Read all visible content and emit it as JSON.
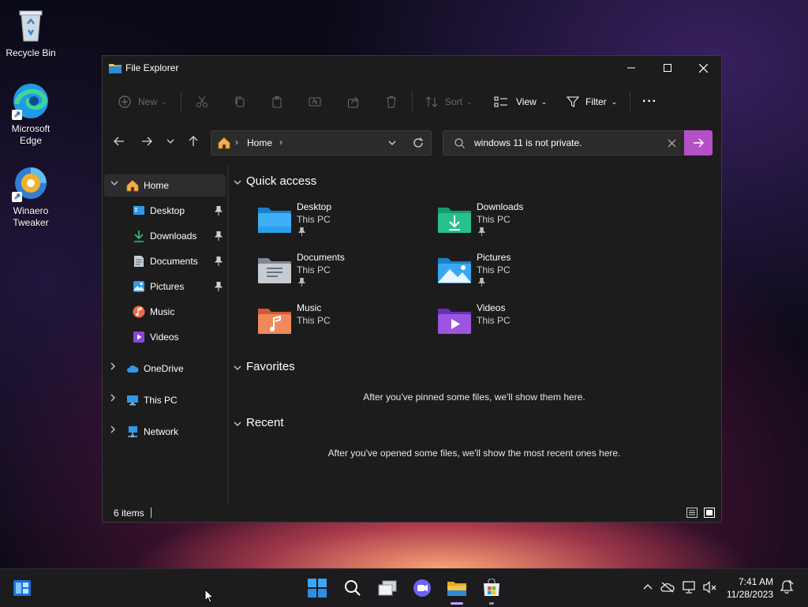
{
  "desktop": {
    "icons": [
      {
        "label": "Recycle Bin"
      },
      {
        "label": "Microsoft Edge"
      },
      {
        "label": "Winaero Tweaker"
      }
    ]
  },
  "window": {
    "title": "File Explorer",
    "controls": {
      "minimize": "—",
      "maximize": "☐",
      "close": "✕"
    }
  },
  "commandbar": {
    "new_label": "New",
    "sort_label": "Sort",
    "view_label": "View",
    "filter_label": "Filter",
    "more_label": "···"
  },
  "address": {
    "crumb": "Home",
    "separator": "›"
  },
  "search": {
    "value": "windows 11 is not private."
  },
  "nav": {
    "home": "Home",
    "quick": [
      {
        "label": "Desktop",
        "pinned": true
      },
      {
        "label": "Downloads",
        "pinned": true
      },
      {
        "label": "Documents",
        "pinned": true
      },
      {
        "label": "Pictures",
        "pinned": true
      },
      {
        "label": "Music",
        "pinned": false
      },
      {
        "label": "Videos",
        "pinned": false
      }
    ],
    "onedrive": "OneDrive",
    "thispc": "This PC",
    "network": "Network"
  },
  "content": {
    "quick_access_title": "Quick access",
    "tiles": [
      {
        "name": "Desktop",
        "location": "This PC",
        "pinned": true
      },
      {
        "name": "Downloads",
        "location": "This PC",
        "pinned": true
      },
      {
        "name": "Documents",
        "location": "This PC",
        "pinned": true
      },
      {
        "name": "Pictures",
        "location": "This PC",
        "pinned": true
      },
      {
        "name": "Music",
        "location": "This PC",
        "pinned": false
      },
      {
        "name": "Videos",
        "location": "This PC",
        "pinned": false
      }
    ],
    "favorites_title": "Favorites",
    "favorites_empty": "After you've pinned some files, we'll show them here.",
    "recent_title": "Recent",
    "recent_empty": "After you've opened some files, we'll show the most recent ones here."
  },
  "status": {
    "items_count": "6 items"
  },
  "taskbar": {
    "time": "7:41 AM",
    "date": "11/28/2023"
  },
  "colors": {
    "accent": "#b550c7",
    "window_bg": "#1c1c1c",
    "folder_blue": "#3aa0f0",
    "folder_yellow": "#f4c542"
  }
}
